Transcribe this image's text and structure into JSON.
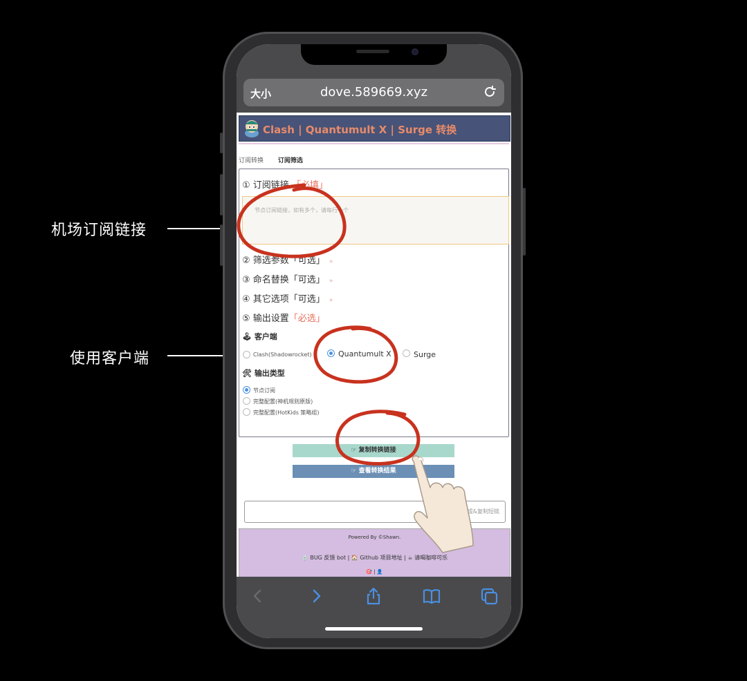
{
  "callouts": {
    "subscription": "机场订阅链接",
    "client": "使用客户端"
  },
  "browser": {
    "text_size_label": "大小",
    "url": "dove.589669.xyz"
  },
  "page": {
    "header_title": "Clash | Quantumult X | Surge 转换",
    "tabs": [
      "订阅转换",
      "订阅筛选"
    ],
    "steps": {
      "s1": "① 订阅链接",
      "s1_tag": "「必填」",
      "s2": "② 筛选参数",
      "s2_tag": "「可选」",
      "s3": "③ 命名替换",
      "s3_tag": "「可选」",
      "s4": "④ 其它选项",
      "s4_tag": "「可选」",
      "s5": "⑤ 输出设置",
      "s5_tag": "「必选」"
    },
    "chevron": "»",
    "sub_placeholder": "节点订阅链接，如有多个，请每行一个",
    "client_label": "客户端",
    "clients": [
      "Clash(Shadowrocket)",
      "Quantumult X",
      "Surge"
    ],
    "selected_client": "Quantumult X",
    "output_label": "输出类型",
    "outputs": [
      "节点订阅",
      "完整配置(神机规则原版)",
      "完整配置(HotKids 策略组)"
    ],
    "selected_output": "节点订阅",
    "copy_button": "☞ 复制转换链接",
    "view_button": "☞ 查看转换结果",
    "shortlink_button": "生成&复制短链",
    "powered": "Powered By ©Shawn.",
    "footer_links": "🍵 BUG 反馈 bot   |   🏠 Github 项目地址   |   ☕ 请喝咖啡可乐",
    "footer_icons": "🎯 | 👤"
  }
}
